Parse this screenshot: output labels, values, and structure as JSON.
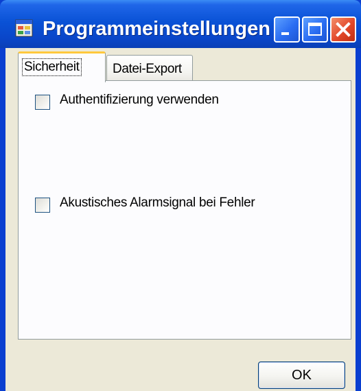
{
  "window": {
    "title": "Programmeinstellungen",
    "app_icon": "settings-window-icon",
    "controls": [
      "minimize-icon",
      "maximize-icon",
      "close-icon"
    ]
  },
  "tabs": [
    {
      "label": "Sicherheit",
      "active": true
    },
    {
      "label": "Datei-Export",
      "active": false
    }
  ],
  "options": {
    "authentication": {
      "label": "Authentifizierung verwenden",
      "checked": false
    },
    "alarm": {
      "label": "Akustisches Alarmsignal bei Fehler",
      "checked": false
    }
  },
  "footer": {
    "ok_label": "OK"
  },
  "colors": {
    "title_bar": "#0a52d6",
    "close_button": "#e2482a",
    "dialog_face": "#ece9d8",
    "active_tab_accent": "#ffc83c"
  }
}
